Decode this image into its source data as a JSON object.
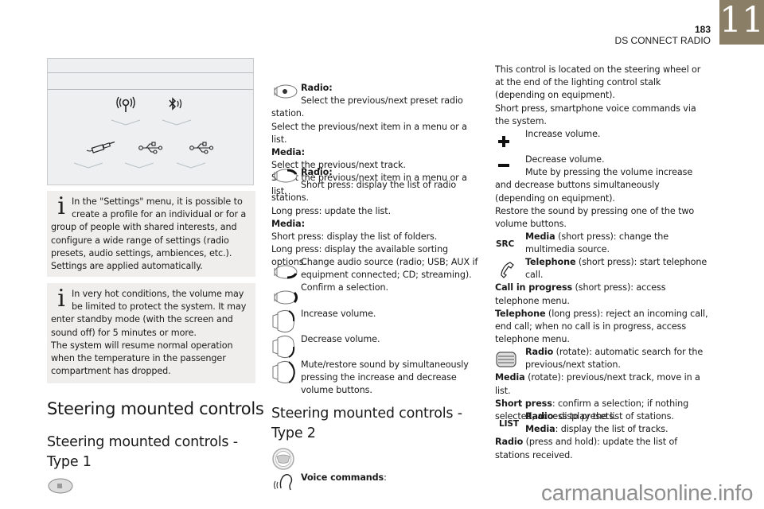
{
  "header": {
    "page_number": "183",
    "section_title": "DS CONNECT RADIO",
    "chapter_number": "11",
    "chapter_color": "#8b7e66"
  },
  "figure": {
    "icons_row1": [
      "radio-antenna-icon",
      "bluetooth-audio-icon"
    ],
    "icons_row2": [
      "aux-jack-icon",
      "usb-icon",
      "usb-icon"
    ]
  },
  "info_boxes": [
    {
      "icon": "info-icon",
      "text": "In the \"Settings\" menu, it is possible to create a profile for an individual or for a group of people with shared interests, and configure a wide range of settings (radio presets, audio settings, ambiences, etc.). Settings are applied automatically."
    },
    {
      "icon": "info-icon",
      "text1": "In very hot conditions, the volume may be limited to protect the system. It may enter standby mode (with the screen and sound off) for 5 minutes or more.",
      "text2": "The system will resume normal operation when the temperature in the passenger compartment has dropped."
    }
  ],
  "left_col": {
    "heading": "Steering mounted controls",
    "subheading": "Steering mounted controls - Type 1"
  },
  "mid_col": {
    "items": [
      {
        "icon": "steering-control-thumbwheel-icon",
        "lines": [
          {
            "bold": "Radio:"
          },
          {
            "text": "Select the previous/next preset radio station."
          },
          {
            "text": "Select the previous/next item in a menu or a list."
          },
          {
            "bold": "Media:"
          },
          {
            "text": "Select the previous/next track."
          },
          {
            "text": "Select the previous/next item in a menu or a list."
          }
        ]
      },
      {
        "icon": "steering-control-upper-button-icon",
        "lines": [
          {
            "bold": "Radio:"
          },
          {
            "text": "Short press: display the list of radio stations."
          },
          {
            "text": "Long press: update the list."
          },
          {
            "bold": "Media:"
          },
          {
            "text": "Short press: display the list of folders."
          },
          {
            "text": "Long press: display the available sorting options."
          }
        ]
      },
      {
        "icon": "steering-control-lower-button-icon",
        "text": "Change audio source (radio; USB; AUX if equipment connected; CD; streaming)."
      },
      {
        "icon": "steering-control-end-button-icon",
        "text": "Confirm a selection."
      },
      {
        "icon": "volume-up-control-icon",
        "text": "Increase volume."
      },
      {
        "icon": "volume-down-control-icon",
        "text": "Decrease volume."
      },
      {
        "icon": "volume-both-control-icon",
        "text": "Mute/restore sound by simultaneously pressing the increase and decrease volume buttons."
      }
    ],
    "subheading": "Steering mounted controls - Type 2",
    "voice_label": "Voice commands",
    "voice_colon": ":"
  },
  "right_col": {
    "intro1": "This control is located on the steering wheel or at the end of the lighting control stalk (depending on equipment).",
    "intro2": "Short press, smartphone voice commands via the system.",
    "plus_text": "Increase volume.",
    "minus_text1": "Decrease volume.",
    "minus_text2": "Mute by pressing the volume increase and decrease buttons simultaneously (depending on equipment).",
    "restore_text": "Restore the sound by pressing one of the two volume buttons.",
    "src_label": "SRC",
    "src_bold": "Media",
    "src_text": " (short press): change the multimedia source.",
    "tel_bold": "Telephone",
    "tel_text": " (short press): start telephone call.",
    "call_bold": "Call in progress",
    "call_text": " (short press): access telephone menu.",
    "tel_long_bold": "Telephone",
    "tel_long_text": " (long press): reject an incoming call, end call; when no call is in progress, access telephone menu.",
    "wheel_bold": "Radio",
    "wheel_text": " (rotate): automatic search for the previous/next station.",
    "media_rot_bold": "Media",
    "media_rot_text": " (rotate): previous/next track, move in a list.",
    "short_bold": "Short press",
    "short_text": ": confirm a selection; if nothing selected, access to presets.",
    "list_label": "LIST",
    "list_radio_bold": "Radio",
    "list_radio_text": ": display the list of stations.",
    "list_media_bold": "Media",
    "list_media_text": ": display the list of tracks.",
    "hold_bold": "Radio",
    "hold_text": " (press and hold): update the list of stations received."
  },
  "watermark": "carmanualsonline.info"
}
